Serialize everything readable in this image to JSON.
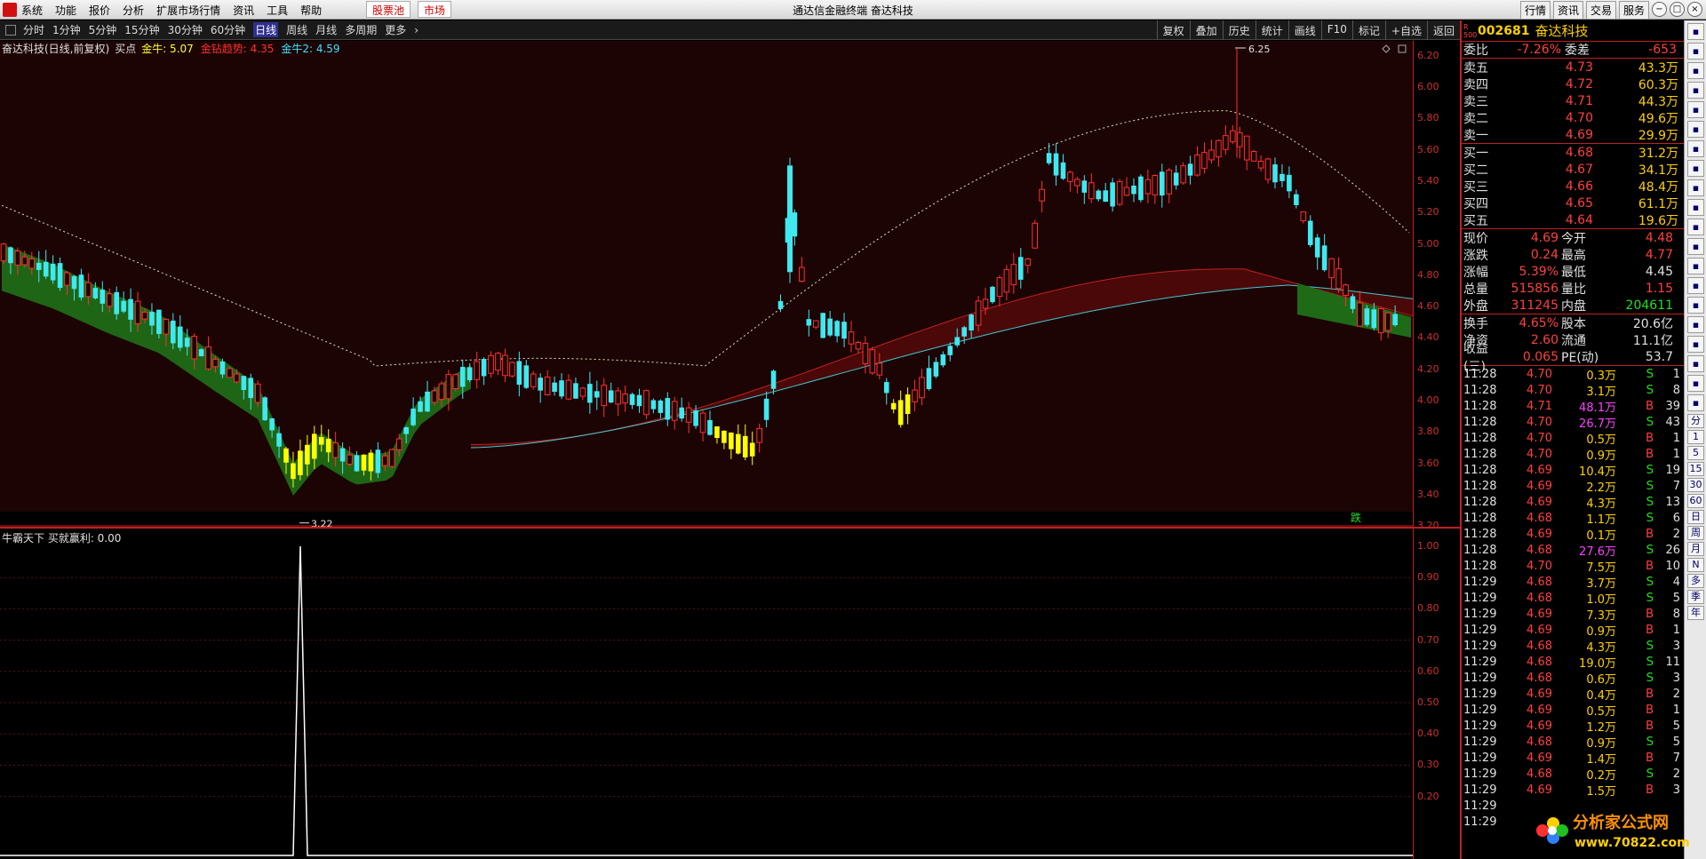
{
  "menubar": {
    "items": [
      "系统",
      "功能",
      "报价",
      "分析",
      "扩展市场行情",
      "资讯",
      "工具",
      "帮助"
    ],
    "hot_button": "股票池",
    "market_button": "市场",
    "title": "通达信金融终端  奋达科技",
    "right_buttons": [
      "行情",
      "资讯",
      "交易",
      "服务"
    ]
  },
  "toolbar": {
    "periods": [
      "分时",
      "1分钟",
      "5分钟",
      "15分钟",
      "30分钟",
      "60分钟",
      "日线",
      "周线",
      "月线",
      "多周期",
      "更多"
    ],
    "active_period": "日线",
    "right_items": [
      "复权",
      "叠加",
      "历史",
      "统计",
      "画线",
      "F10",
      "标记",
      "+自选",
      "返回"
    ]
  },
  "main_chart": {
    "header": {
      "title": "奋达科技(日线,前复权)",
      "ind_name": "买点",
      "ind1": "金牛: 5.07",
      "ind2": "金钻趋势: 4.35",
      "ind3": "金牛2: 4.59"
    },
    "high_label": "6.25",
    "low_label": "3.22",
    "down_marker": "跌",
    "y_ticks": [
      "6.20",
      "6.00",
      "5.80",
      "5.60",
      "5.40",
      "5.20",
      "5.00",
      "4.80",
      "4.60",
      "4.40",
      "4.20",
      "4.00",
      "3.80",
      "3.60",
      "3.40",
      "3.20"
    ]
  },
  "sub_chart": {
    "header": "牛霸天下  买就赢利: 0.00",
    "y_ticks": [
      "1.00",
      "0.90",
      "0.80",
      "0.70",
      "0.60",
      "0.50",
      "0.40",
      "0.30",
      "0.20"
    ]
  },
  "quote": {
    "tag": "R 500",
    "code": "002681",
    "name": "奋达科技",
    "weibi_label": "委比",
    "weibi": "-7.26%",
    "weicha_label": "委差",
    "weicha": "-653",
    "asks": [
      {
        "label": "卖五",
        "price": "4.73",
        "vol": "43.3万"
      },
      {
        "label": "卖四",
        "price": "4.72",
        "vol": "60.3万"
      },
      {
        "label": "卖三",
        "price": "4.71",
        "vol": "44.3万"
      },
      {
        "label": "卖二",
        "price": "4.70",
        "vol": "49.6万"
      },
      {
        "label": "卖一",
        "price": "4.69",
        "vol": "29.9万"
      }
    ],
    "bids": [
      {
        "label": "买一",
        "price": "4.68",
        "vol": "31.2万"
      },
      {
        "label": "买二",
        "price": "4.67",
        "vol": "34.1万"
      },
      {
        "label": "买三",
        "price": "4.66",
        "vol": "48.4万"
      },
      {
        "label": "买四",
        "price": "4.65",
        "vol": "61.1万"
      },
      {
        "label": "买五",
        "price": "4.64",
        "vol": "19.6万"
      }
    ],
    "stats": [
      {
        "l1": "现价",
        "v1": "4.69",
        "l2": "今开",
        "v2": "4.48",
        "c2": "red"
      },
      {
        "l1": "涨跌",
        "v1": "0.24",
        "l2": "最高",
        "v2": "4.77",
        "c2": "red"
      },
      {
        "l1": "涨幅",
        "v1": "5.39%",
        "l2": "最低",
        "v2": "4.45",
        "c2": "white"
      },
      {
        "l1": "总量",
        "v1": "515856",
        "l2": "量比",
        "v2": "1.15",
        "c2": "red"
      },
      {
        "l1": "外盘",
        "v1": "311245",
        "l2": "内盘",
        "v2": "204611",
        "c2": "green"
      }
    ],
    "stats2": [
      {
        "l1": "换手",
        "v1": "4.65%",
        "l2": "股本",
        "v2": "20.6亿"
      },
      {
        "l1": "净资",
        "v1": "2.60",
        "l2": "流通",
        "v2": "11.1亿"
      },
      {
        "l1": "收益(三)",
        "v1": "0.065",
        "l2": "PE(动)",
        "v2": "53.7"
      }
    ]
  },
  "ticks": [
    {
      "t": "11:28",
      "p": "4.70",
      "v": "0.3万",
      "s": "S",
      "n": "1",
      "pc": "red",
      "vc": "yel"
    },
    {
      "t": "11:28",
      "p": "4.70",
      "v": "3.1万",
      "s": "S",
      "n": "8",
      "pc": "red",
      "vc": "yel"
    },
    {
      "t": "11:28",
      "p": "4.71",
      "v": "48.1万",
      "s": "B",
      "n": "39",
      "pc": "red",
      "vc": "mag"
    },
    {
      "t": "11:28",
      "p": "4.70",
      "v": "26.7万",
      "s": "S",
      "n": "43",
      "pc": "red",
      "vc": "mag"
    },
    {
      "t": "11:28",
      "p": "4.70",
      "v": "0.5万",
      "s": "B",
      "n": "1",
      "pc": "red",
      "vc": "yel"
    },
    {
      "t": "11:28",
      "p": "4.70",
      "v": "0.9万",
      "s": "B",
      "n": "1",
      "pc": "red",
      "vc": "yel"
    },
    {
      "t": "11:28",
      "p": "4.69",
      "v": "10.4万",
      "s": "S",
      "n": "19",
      "pc": "red",
      "vc": "yel"
    },
    {
      "t": "11:28",
      "p": "4.69",
      "v": "2.2万",
      "s": "S",
      "n": "7",
      "pc": "red",
      "vc": "yel"
    },
    {
      "t": "11:28",
      "p": "4.69",
      "v": "4.3万",
      "s": "S",
      "n": "13",
      "pc": "red",
      "vc": "yel"
    },
    {
      "t": "11:28",
      "p": "4.68",
      "v": "1.1万",
      "s": "S",
      "n": "6",
      "pc": "red",
      "vc": "yel"
    },
    {
      "t": "11:28",
      "p": "4.69",
      "v": "0.1万",
      "s": "B",
      "n": "2",
      "pc": "red",
      "vc": "yel"
    },
    {
      "t": "11:28",
      "p": "4.68",
      "v": "27.6万",
      "s": "S",
      "n": "26",
      "pc": "red",
      "vc": "mag"
    },
    {
      "t": "11:28",
      "p": "4.70",
      "v": "7.5万",
      "s": "B",
      "n": "10",
      "pc": "red",
      "vc": "yel"
    },
    {
      "t": "11:29",
      "p": "4.68",
      "v": "3.7万",
      "s": "S",
      "n": "4",
      "pc": "red",
      "vc": "yel"
    },
    {
      "t": "11:29",
      "p": "4.68",
      "v": "1.0万",
      "s": "S",
      "n": "5",
      "pc": "red",
      "vc": "yel"
    },
    {
      "t": "11:29",
      "p": "4.69",
      "v": "7.3万",
      "s": "B",
      "n": "8",
      "pc": "red",
      "vc": "yel"
    },
    {
      "t": "11:29",
      "p": "4.69",
      "v": "0.9万",
      "s": "B",
      "n": "1",
      "pc": "red",
      "vc": "yel"
    },
    {
      "t": "11:29",
      "p": "4.68",
      "v": "4.3万",
      "s": "S",
      "n": "3",
      "pc": "red",
      "vc": "yel"
    },
    {
      "t": "11:29",
      "p": "4.68",
      "v": "19.0万",
      "s": "S",
      "n": "11",
      "pc": "red",
      "vc": "yel"
    },
    {
      "t": "11:29",
      "p": "4.68",
      "v": "0.6万",
      "s": "S",
      "n": "3",
      "pc": "red",
      "vc": "yel"
    },
    {
      "t": "11:29",
      "p": "4.69",
      "v": "0.4万",
      "s": "B",
      "n": "2",
      "pc": "red",
      "vc": "yel"
    },
    {
      "t": "11:29",
      "p": "4.69",
      "v": "0.5万",
      "s": "B",
      "n": "1",
      "pc": "red",
      "vc": "yel"
    },
    {
      "t": "11:29",
      "p": "4.69",
      "v": "1.2万",
      "s": "B",
      "n": "5",
      "pc": "red",
      "vc": "yel"
    },
    {
      "t": "11:29",
      "p": "4.68",
      "v": "0.9万",
      "s": "S",
      "n": "5",
      "pc": "red",
      "vc": "yel"
    },
    {
      "t": "11:29",
      "p": "4.69",
      "v": "1.4万",
      "s": "B",
      "n": "7",
      "pc": "red",
      "vc": "yel"
    },
    {
      "t": "11:29",
      "p": "4.68",
      "v": "0.2万",
      "s": "S",
      "n": "2",
      "pc": "red",
      "vc": "yel"
    },
    {
      "t": "11:29",
      "p": "4.69",
      "v": "1.5万",
      "s": "B",
      "n": "3",
      "pc": "red",
      "vc": "yel"
    },
    {
      "t": "11:29",
      "p": "",
      "v": "",
      "s": "",
      "n": "",
      "pc": "red",
      "vc": "yel"
    },
    {
      "t": "11:29",
      "p": "",
      "v": "",
      "s": "",
      "n": "",
      "pc": "red",
      "vc": "yel"
    }
  ],
  "side_toolbar": [
    "分",
    "1",
    "5",
    "15",
    "30",
    "60",
    "日",
    "周",
    "月",
    "N",
    "多",
    "季",
    "年"
  ],
  "logo": {
    "text": "分析家公式网",
    "url_text": "www.70822.com"
  },
  "colors": {
    "up": "#ff3030",
    "down": "#40e8f0",
    "signal": "#ffff00",
    "bg_bull": "#1a0404",
    "accent": "#c02020"
  }
}
